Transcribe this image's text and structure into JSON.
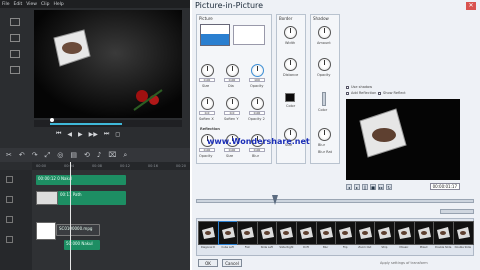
{
  "editor": {
    "menu": [
      "File",
      "Edit",
      "View",
      "Clip",
      "Help"
    ],
    "controls": [
      "⏮",
      "◀",
      "▶",
      "▶▶",
      "⏭",
      "◻"
    ],
    "toolbar_icons": [
      "✂",
      "↶",
      "↷",
      "⤢",
      "◎",
      "▤",
      "⟲",
      "♪",
      "⌧",
      "⌕"
    ],
    "ruler_ticks": [
      "00:00",
      "00:04",
      "00:08",
      "00:12",
      "00:16",
      "00:20"
    ],
    "clips": {
      "video_a": "00:00:12 0 Nakul",
      "video_b": "00:11 Path",
      "audio_a": "SC0100000.mpg",
      "audio_b": "50:000 Nakul"
    }
  },
  "dialog": {
    "title": "Picture-in-Picture",
    "groups": {
      "picture": "Picture",
      "border": "Border",
      "shadow": "Shadow",
      "reflection": "Reflection"
    },
    "knob_values": [
      "0.00",
      "0.00",
      "100",
      "0.0",
      "0.0",
      "0.00",
      "0.00",
      "0.00",
      "0.00",
      "0.00",
      "0.00",
      "0.00",
      "0.00",
      "0.00"
    ],
    "knob_labels": [
      "Size",
      "Dia",
      "Opacity",
      "Soften X",
      "Soften Y",
      "Opacity 2",
      "Opacity",
      "Size",
      "Blur",
      "Distance",
      "Size",
      "Blur Rat",
      "Amount",
      "Opacity"
    ],
    "side_labels": [
      "Width",
      "Color",
      "Color",
      "Blur"
    ],
    "checkbox_labels": [
      "Use shadow",
      "Add Reflection",
      "Show Reflect"
    ],
    "watermark": "www.Wondershare.net",
    "timecode": "00:00:01:17",
    "thumbnails": [
      "Diagonal D",
      "Cube Left",
      "Flat",
      "Slide Left",
      "Slide Right",
      "Drift",
      "Blur",
      "Flip",
      "Zoom Out",
      "Strip",
      "Mosaic",
      "Mixed",
      "Double Slide",
      "Double Slide"
    ],
    "buttons": {
      "ok": "OK",
      "cancel": "Cancel"
    },
    "status_text": "Apply settings of transform"
  },
  "colors": {
    "accent": "#1d8e63",
    "playhead": "#3fb8d8",
    "blue_knob": "#3d8fd6"
  }
}
